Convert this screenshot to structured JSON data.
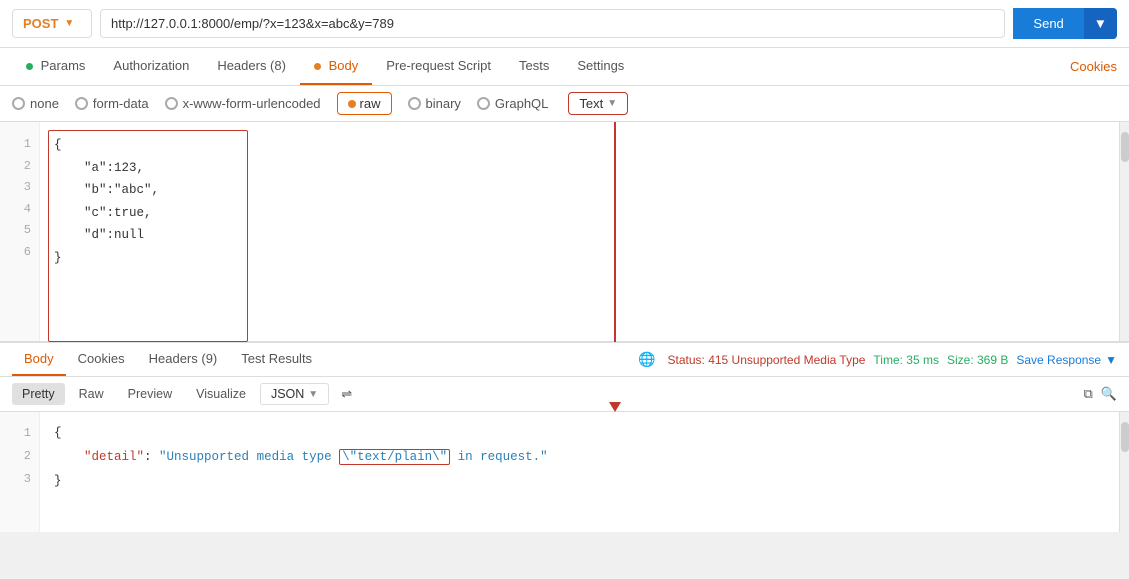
{
  "urlBar": {
    "method": "POST",
    "url": "http://127.0.0.1:8000/emp/?x=123&x=abc&y=789",
    "sendLabel": "Send"
  },
  "tabs": {
    "items": [
      {
        "id": "params",
        "label": "Params",
        "dot": "green",
        "active": false
      },
      {
        "id": "authorization",
        "label": "Authorization",
        "dot": null,
        "active": false
      },
      {
        "id": "headers",
        "label": "Headers (8)",
        "dot": null,
        "active": false
      },
      {
        "id": "body",
        "label": "Body",
        "dot": "orange",
        "active": true
      },
      {
        "id": "pre-request",
        "label": "Pre-request Script",
        "dot": null,
        "active": false
      },
      {
        "id": "tests",
        "label": "Tests",
        "dot": null,
        "active": false
      },
      {
        "id": "settings",
        "label": "Settings",
        "dot": null,
        "active": false
      }
    ],
    "cookies": "Cookies"
  },
  "bodyOptions": {
    "none": "none",
    "formData": "form-data",
    "urlencoded": "x-www-form-urlencoded",
    "raw": "raw",
    "binary": "binary",
    "graphql": "GraphQL",
    "textDropdown": "Text"
  },
  "requestCode": {
    "lines": [
      {
        "num": 1,
        "text": "{"
      },
      {
        "num": 2,
        "text": "    \"a\":123,"
      },
      {
        "num": 3,
        "text": "    \"b\":\"abc\","
      },
      {
        "num": 4,
        "text": "    \"c\":true,"
      },
      {
        "num": 5,
        "text": "    \"d\":null"
      },
      {
        "num": 6,
        "text": "}"
      }
    ]
  },
  "responseTabs": {
    "items": [
      {
        "id": "body",
        "label": "Body",
        "active": true
      },
      {
        "id": "cookies",
        "label": "Cookies",
        "active": false
      },
      {
        "id": "headers",
        "label": "Headers (9)",
        "active": false
      },
      {
        "id": "testResults",
        "label": "Test Results",
        "active": false
      }
    ],
    "status": "Status: 415 Unsupported Media Type",
    "time": "Time: 35 ms",
    "size": "Size: 369 B",
    "saveResponse": "Save Response"
  },
  "formatBar": {
    "pretty": "Pretty",
    "raw": "Raw",
    "preview": "Preview",
    "visualize": "Visualize",
    "format": "JSON"
  },
  "responseCode": {
    "lines": [
      {
        "num": 1,
        "text": "{"
      },
      {
        "num": 2,
        "key": "\"detail\"",
        "value": "\"Unsupported media type \\\"text/plain\\\" in request.\""
      },
      {
        "num": 3,
        "text": "}"
      }
    ]
  }
}
